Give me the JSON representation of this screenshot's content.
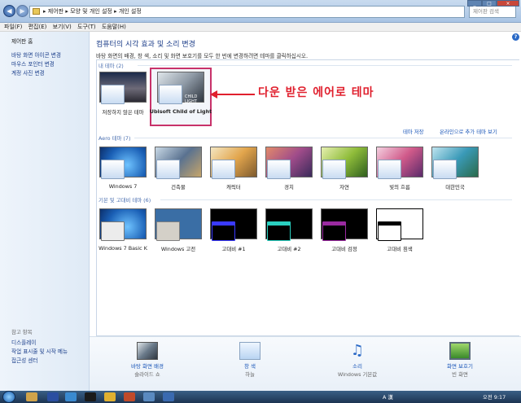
{
  "address": {
    "crumb1": "제어판",
    "crumb2": "모양 및 개인 설정",
    "crumb3": "개인 설정",
    "search_placeholder": "제어판 검색"
  },
  "menu": {
    "file": "파일(F)",
    "edit": "편집(E)",
    "view": "보기(V)",
    "tools": "도구(T)",
    "help": "도움말(H)"
  },
  "left": {
    "home": "제어판 홈",
    "link1": "바탕 화면 아이콘 변경",
    "link2": "마우스 포인터 변경",
    "link3": "계정 사진 변경",
    "see_also": "참고 항목",
    "sa1": "디스플레이",
    "sa2": "작업 표시줄 및 시작 메뉴",
    "sa3": "접근성 센터"
  },
  "main": {
    "title": "컴퓨터의 시각 효과 및 소리 변경",
    "subtitle": "바탕 화면의 배경, 창 색, 소리 및 화면 보호기를 모두 한 번에 변경하려면 테마를 클릭하십시오.",
    "my_themes": "내 테마 (2)",
    "my": [
      {
        "label": "저장하지 않은 테마"
      },
      {
        "label": "Ubisoft Child of Light",
        "overlay": "CHILD LIGHT"
      }
    ],
    "save_theme": "테마 저장",
    "more_themes": "온라인으로 추가 테마 보기",
    "aero_group": "Aero 테마 (7)",
    "aero": [
      {
        "label": "Windows 7"
      },
      {
        "label": "건축물"
      },
      {
        "label": "캐릭터"
      },
      {
        "label": "경치"
      },
      {
        "label": "자연"
      },
      {
        "label": "빛의 흐름"
      },
      {
        "label": "대한민국"
      }
    ],
    "basic_group": "기본 및 고대비 테마 (6)",
    "basic": [
      {
        "label": "Windows 7 Basic K"
      },
      {
        "label": "Windows 고전"
      },
      {
        "label": "고대비 #1"
      },
      {
        "label": "고대비 #2"
      },
      {
        "label": "고대비 검정"
      },
      {
        "label": "고대비 흰색"
      }
    ],
    "callout": "다운 받은 에어로 테마"
  },
  "bottom": [
    {
      "title": "바탕 화면 배경",
      "value": "슬라이드 쇼"
    },
    {
      "title": "창 색",
      "value": "하늘"
    },
    {
      "title": "소리",
      "value": "Windows 기본값"
    },
    {
      "title": "화면 보호기",
      "value": "빈 화면"
    }
  ],
  "tray": {
    "ime": "A 漢",
    "time": "오전 9:17"
  },
  "colors": {
    "accent": "#1a56b8",
    "callout": "#e0202e",
    "selection": "#c8326a"
  }
}
